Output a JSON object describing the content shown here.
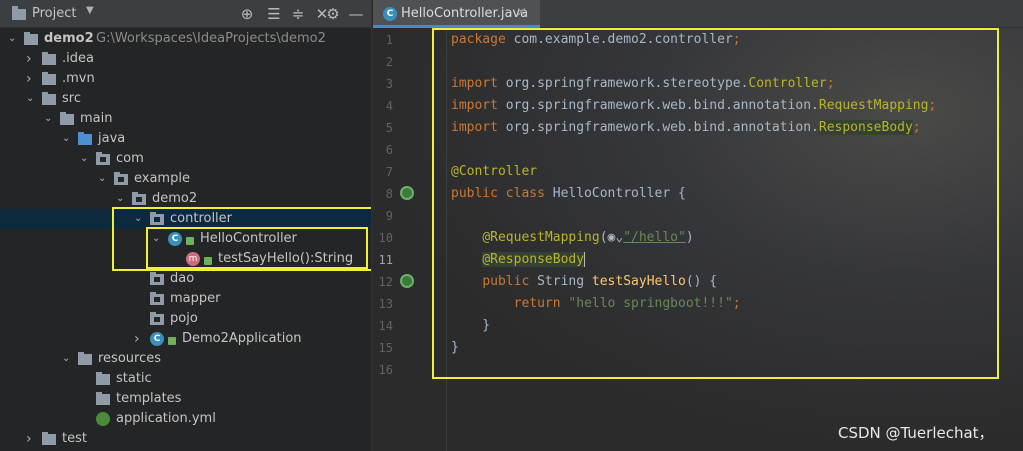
{
  "project_panel": {
    "title": "Project",
    "icons": [
      "add-icon",
      "collapse-all-icon",
      "expand-all-icon",
      "close-icon",
      "gear-icon",
      "minimize-icon"
    ],
    "tree": [
      {
        "label": "demo2",
        "path": "G:\\Workspaces\\IdeaProjects\\demo2",
        "arrow": "⌵",
        "icon": "folder-icon"
      },
      {
        "label": ".idea",
        "arrow": "›",
        "icon": "folder-icon"
      },
      {
        "label": ".mvn",
        "arrow": "›",
        "icon": "folder-icon"
      },
      {
        "label": "src",
        "arrow": "⌵",
        "icon": "folder-icon"
      },
      {
        "label": "main",
        "arrow": "⌵",
        "icon": "folder-icon"
      },
      {
        "label": "java",
        "arrow": "⌵",
        "icon": "source-folder-icon"
      },
      {
        "label": "com",
        "arrow": "⌵",
        "icon": "package-icon"
      },
      {
        "label": "example",
        "arrow": "⌵",
        "icon": "package-icon"
      },
      {
        "label": "demo2",
        "arrow": "⌵",
        "icon": "package-icon"
      },
      {
        "label": "controller",
        "arrow": "⌵",
        "icon": "package-icon"
      },
      {
        "label": "HelloController",
        "arrow": "⌵",
        "icon": "class-icon"
      },
      {
        "label": "testSayHello():String",
        "arrow": "",
        "icon": "method-icon"
      },
      {
        "label": "dao",
        "arrow": "",
        "icon": "package-icon"
      },
      {
        "label": "mapper",
        "arrow": "",
        "icon": "package-icon"
      },
      {
        "label": "pojo",
        "arrow": "",
        "icon": "package-icon"
      },
      {
        "label": "Demo2Application",
        "arrow": "›",
        "icon": "spring-class-icon"
      },
      {
        "label": "resources",
        "arrow": "⌵",
        "icon": "resources-folder-icon"
      },
      {
        "label": "static",
        "arrow": "",
        "icon": "folder-icon"
      },
      {
        "label": "templates",
        "arrow": "",
        "icon": "folder-icon"
      },
      {
        "label": "application.yml",
        "arrow": "",
        "icon": "yaml-file-icon"
      },
      {
        "label": "test",
        "arrow": "›",
        "icon": "folder-icon"
      }
    ]
  },
  "editor": {
    "tab_label": "HelloController.java",
    "tab_close": "×",
    "current_line": 11,
    "lines": [
      {
        "n": "1",
        "segs": [
          {
            "t": "package ",
            "c": "kw"
          },
          {
            "t": "com.example.demo2.controller",
            "c": ""
          },
          {
            "t": ";",
            "c": "kw"
          }
        ]
      },
      {
        "n": "2",
        "segs": []
      },
      {
        "n": "3",
        "segs": [
          {
            "t": "import ",
            "c": "kw"
          },
          {
            "t": "org.springframework.stereotype.",
            "c": ""
          },
          {
            "t": "Controller",
            "c": "ann"
          },
          {
            "t": ";",
            "c": "kw"
          }
        ]
      },
      {
        "n": "4",
        "segs": [
          {
            "t": "import ",
            "c": "kw"
          },
          {
            "t": "org.springframework.web.bind.annotation.",
            "c": ""
          },
          {
            "t": "RequestMapping",
            "c": "ann"
          },
          {
            "t": ";",
            "c": "kw"
          }
        ]
      },
      {
        "n": "5",
        "segs": [
          {
            "t": "import ",
            "c": "kw"
          },
          {
            "t": "org.springframework.web.bind.annotation.",
            "c": ""
          },
          {
            "t": "ResponseBody",
            "c": "ann hlbg"
          },
          {
            "t": ";",
            "c": "kw"
          }
        ]
      },
      {
        "n": "6",
        "segs": []
      },
      {
        "n": "7",
        "segs": [
          {
            "t": "@Controller",
            "c": "ann"
          }
        ]
      },
      {
        "n": "8",
        "segs": [
          {
            "t": "public class ",
            "c": "kw"
          },
          {
            "t": "HelloController {",
            "c": ""
          }
        ]
      },
      {
        "n": "9",
        "segs": []
      },
      {
        "n": "10",
        "segs": [
          {
            "t": "    ",
            "c": ""
          },
          {
            "t": "@RequestMapping",
            "c": "ann"
          },
          {
            "t": "(",
            "c": ""
          },
          {
            "t": "◉⌄",
            "c": ""
          },
          {
            "t": "\"/hello\"",
            "c": "str ul"
          },
          {
            "t": ")",
            "c": ""
          }
        ]
      },
      {
        "n": "11",
        "segs": [
          {
            "t": "    ",
            "c": ""
          },
          {
            "t": "@ResponseBody",
            "c": "ann hlbg cursor"
          }
        ]
      },
      {
        "n": "12",
        "segs": [
          {
            "t": "    ",
            "c": ""
          },
          {
            "t": "public ",
            "c": "kw"
          },
          {
            "t": "String ",
            "c": ""
          },
          {
            "t": "testSayHello",
            "c": "fn"
          },
          {
            "t": "() {",
            "c": ""
          }
        ]
      },
      {
        "n": "13",
        "segs": [
          {
            "t": "        ",
            "c": ""
          },
          {
            "t": "return ",
            "c": "kw"
          },
          {
            "t": "\"hello springboot!!!\"",
            "c": "str"
          },
          {
            "t": ";",
            "c": "kw"
          }
        ]
      },
      {
        "n": "14",
        "segs": [
          {
            "t": "    }",
            "c": ""
          }
        ]
      },
      {
        "n": "15",
        "segs": [
          {
            "t": "}",
            "c": ""
          }
        ]
      },
      {
        "n": "16",
        "segs": []
      }
    ]
  },
  "watermark": "CSDN @Tuerlechat，",
  "colors": {
    "highlight_box": "#f2ee3c",
    "keyword": "#cc7832",
    "annotation": "#bbb529",
    "string": "#6a8759",
    "method": "#ffc66d",
    "selection": "#0d293e"
  }
}
